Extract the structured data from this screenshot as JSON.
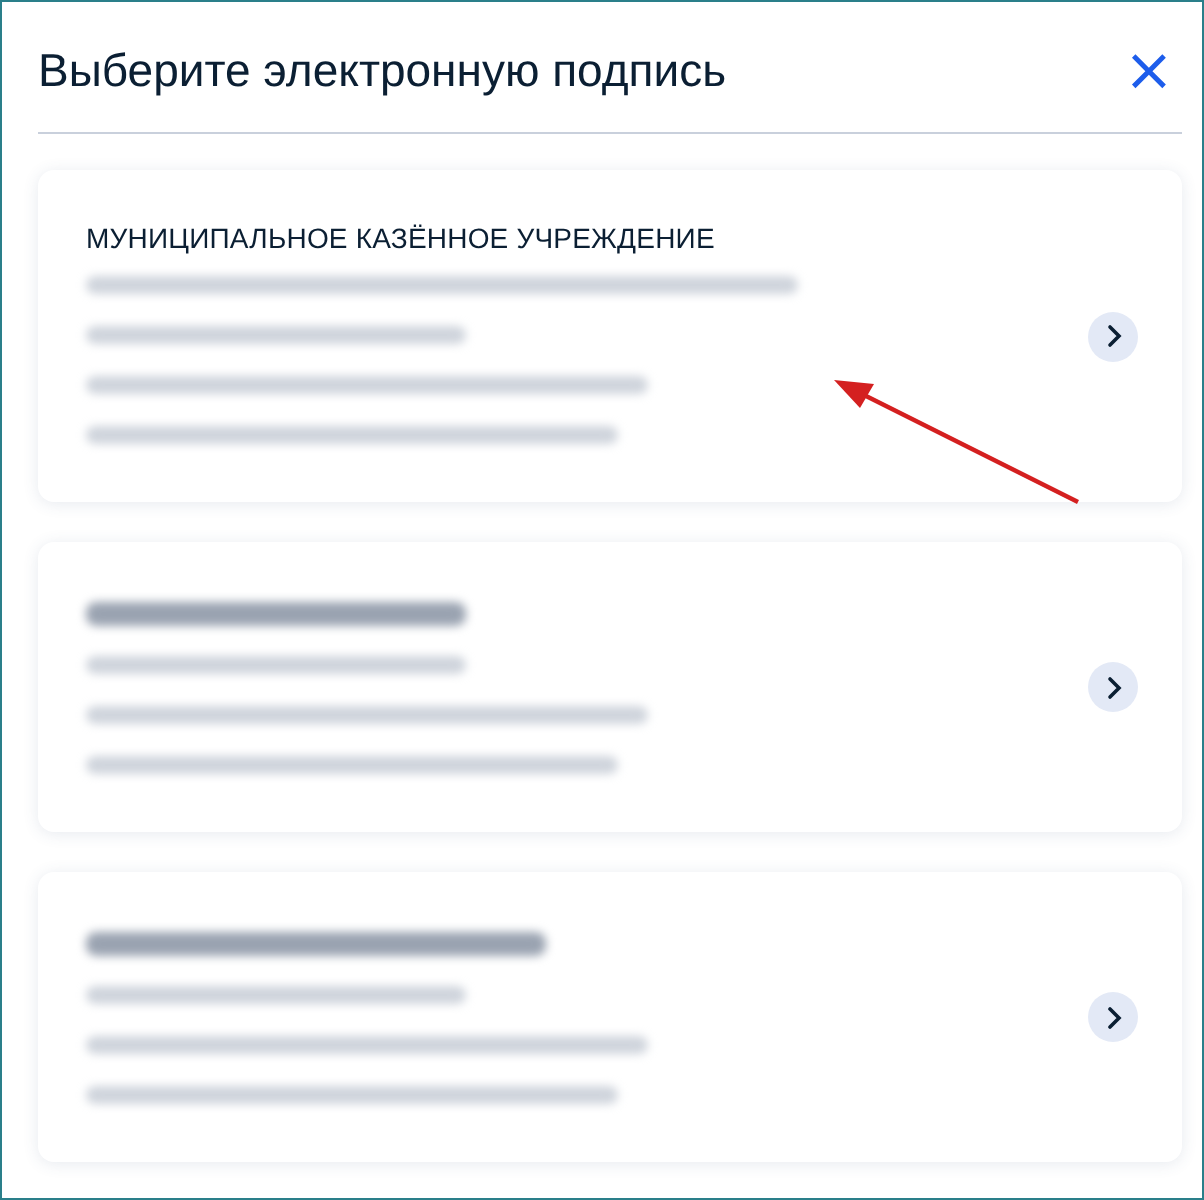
{
  "dialog": {
    "title": "Выберите электронную подпись",
    "close_label": "×"
  },
  "cards": [
    {
      "title": "МУНИЦИПАЛЬНОЕ КАЗЁННОЕ УЧРЕЖДЕНИЕ",
      "redacted": [
        {
          "kind": "line"
        },
        {
          "kind": "line"
        },
        {
          "kind": "line"
        },
        {
          "kind": "line"
        }
      ]
    },
    {
      "redacted": [
        {
          "kind": "heading"
        },
        {
          "kind": "line"
        },
        {
          "kind": "line"
        },
        {
          "kind": "line"
        }
      ]
    },
    {
      "redacted": [
        {
          "kind": "heading"
        },
        {
          "kind": "line"
        },
        {
          "kind": "line"
        },
        {
          "kind": "line"
        }
      ]
    }
  ],
  "annotation": {
    "kind": "arrow"
  }
}
